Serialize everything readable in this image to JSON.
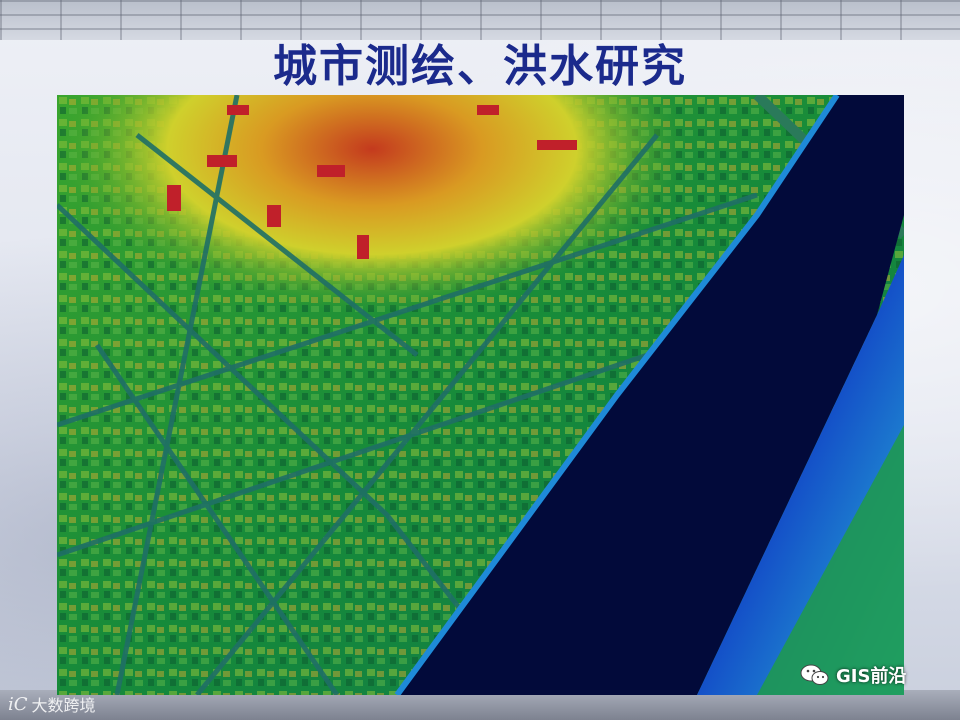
{
  "slide": {
    "title": "城市测绘、洪水研究"
  },
  "image": {
    "subject": "LiDAR elevation map",
    "colors": {
      "river": "#020a3a",
      "high": "#c2261e",
      "mid_high": "#d8c830",
      "mid": "#2f9b2a",
      "low": "#1a8fd0"
    }
  },
  "watermarks": {
    "left_logo": "iC",
    "left_text": "大数跨境",
    "right_icon": "wechat-icon",
    "right_text": "GIS前沿"
  }
}
